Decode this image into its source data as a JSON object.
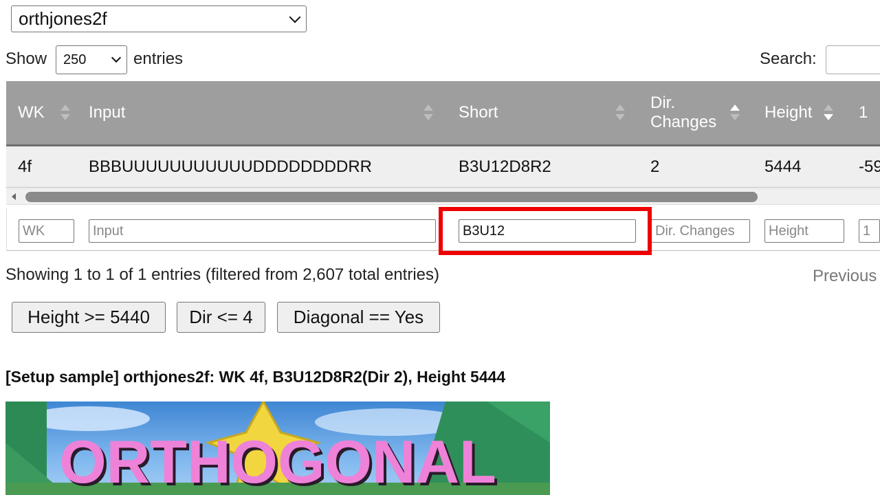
{
  "dataset_select": {
    "value": "orthjones2f"
  },
  "length": {
    "show_label": "Show",
    "value": "250",
    "entries_label": "entries"
  },
  "search": {
    "label": "Search:",
    "value": ""
  },
  "table": {
    "columns": [
      {
        "label": "WK",
        "sort": "both"
      },
      {
        "label": "Input",
        "sort": "both"
      },
      {
        "label": "Short",
        "sort": "both"
      },
      {
        "label_line1": "Dir.",
        "label_line2": "Changes",
        "sort": "asc"
      },
      {
        "label": "Height",
        "sort": "desc"
      },
      {
        "label": "1"
      }
    ],
    "row": {
      "wk": "4f",
      "input": "BBBUUUUUUUUUUUDDDDDDDDRR",
      "short": "B3U12D8R2",
      "dir_changes": "2",
      "height": "5444",
      "col6": "-59"
    }
  },
  "filters": {
    "wk_placeholder": "WK",
    "input_placeholder": "Input",
    "short_value": "B3U12",
    "dir_placeholder": "Dir. Changes",
    "height_placeholder": "Height",
    "col6_placeholder": "1"
  },
  "info": "Showing 1 to 1 of 1 entries (filtered from 2,607 total entries)",
  "pagination": {
    "previous": "Previous"
  },
  "quick_filters": [
    "Height >= 5440",
    "Dir <= 4",
    "Diagonal == Yes"
  ],
  "sample_title": "[Setup sample] orthjones2f: WK 4f, B3U12D8R2(Dir 2), Height 5444",
  "banner": {
    "text": "ORTHOGONAL"
  },
  "colors": {
    "header": "#9e9e9e",
    "highlight": "#ee0000",
    "banner_text": "#ee82d8"
  }
}
